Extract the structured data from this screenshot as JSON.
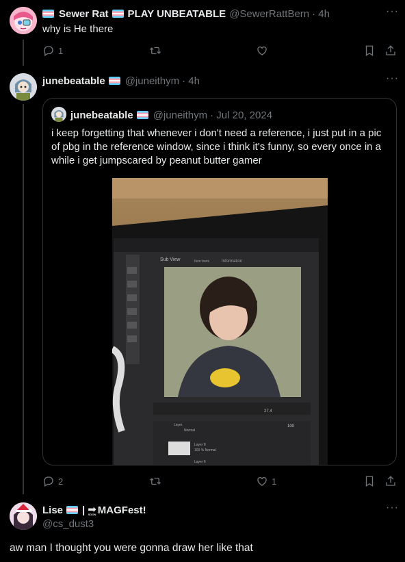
{
  "post1": {
    "name": "Sewer Rat",
    "name_suffix": "PLAY UNBEATABLE",
    "handle": "@SewerRattBern",
    "time": "· 4h",
    "text": "why is He there",
    "reply_count": "1",
    "retweet_count": "",
    "like_count": ""
  },
  "post2": {
    "name": "junebeatable",
    "handle": "@juneithym",
    "time": "· 4h",
    "reply_count": "2",
    "retweet_count": "",
    "like_count": "1",
    "quote": {
      "name": "junebeatable",
      "handle": "@juneithym",
      "time": "· Jul 20, 2024",
      "text": "i keep forgetting that whenever i don't need a reference, i just put in a pic of pbg in the reference window, since i think it's funny, so every once in a while i get jumpscared by peanut butter gamer",
      "image_ui": {
        "sub_view": "Sub View",
        "item_bank": "Item bank",
        "information": "Information",
        "layer": "Layer",
        "normal": "Normal",
        "zoom": "27.4",
        "opacity": "100",
        "layer_a": "Layer 8",
        "layer_a_mode": "100 % Normal",
        "layer_b": "Layer 6"
      }
    }
  },
  "post3": {
    "name": "Lise",
    "name_suffix": "|",
    "name_suffix2": "MAGFest!",
    "soon": "SOON",
    "handle": "@cs_dust3",
    "text": "aw man I thought you were gonna draw her like that"
  },
  "icons": {
    "reply": "reply-icon",
    "retweet": "retweet-icon",
    "like": "heart-icon",
    "bookmark": "bookmark-icon",
    "share": "share-icon",
    "more": "more-icon"
  },
  "colors": {
    "background": "#000000",
    "text": "#e7e9ea",
    "muted": "#71767b",
    "border": "#2f3336"
  }
}
